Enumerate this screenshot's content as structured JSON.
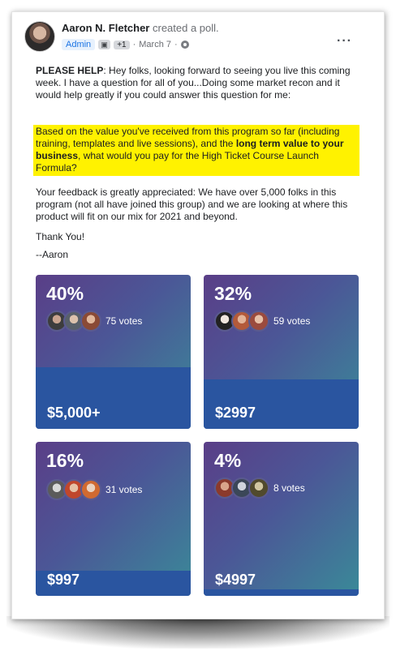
{
  "post": {
    "author": "Aaron N. Fletcher",
    "action": "created a poll.",
    "badge": "Admin",
    "badge_extra": "+1",
    "date": "March 7",
    "separator": "·",
    "more": "···",
    "p1_bold": "PLEASE HELP",
    "p1_text": ": Hey folks, looking forward to seeing you live this coming week. I have a question for all of you...Doing some market recon and it would help greatly if you could answer this question for me:",
    "p2_a": "Based on the value you've received from this program so far (including training, templates and live sessions), and the ",
    "p2_bold": "long term value to your business",
    "p2_b": ", what would you pay for the High Ticket Course Launch Formula?",
    "p3": "Your feedback is greatly appreciated: We have over 5,000 folks in this program (not all have joined this group) and we are looking at where this product will fit on our mix for 2021 and beyond.",
    "p4": "Thank You!",
    "p5": "--Aaron"
  },
  "poll": {
    "options": [
      {
        "percent_label": "40%",
        "votes_label": "75 votes",
        "price": "$5,000+",
        "share": 0.4
      },
      {
        "percent_label": "32%",
        "votes_label": "59 votes",
        "price": "$2997",
        "share": 0.32
      },
      {
        "percent_label": "16%",
        "votes_label": "31 votes",
        "price": "$997",
        "share": 0.16
      },
      {
        "percent_label": "4%",
        "votes_label": "8 votes",
        "price": "$4997",
        "share": 0.04
      }
    ]
  }
}
